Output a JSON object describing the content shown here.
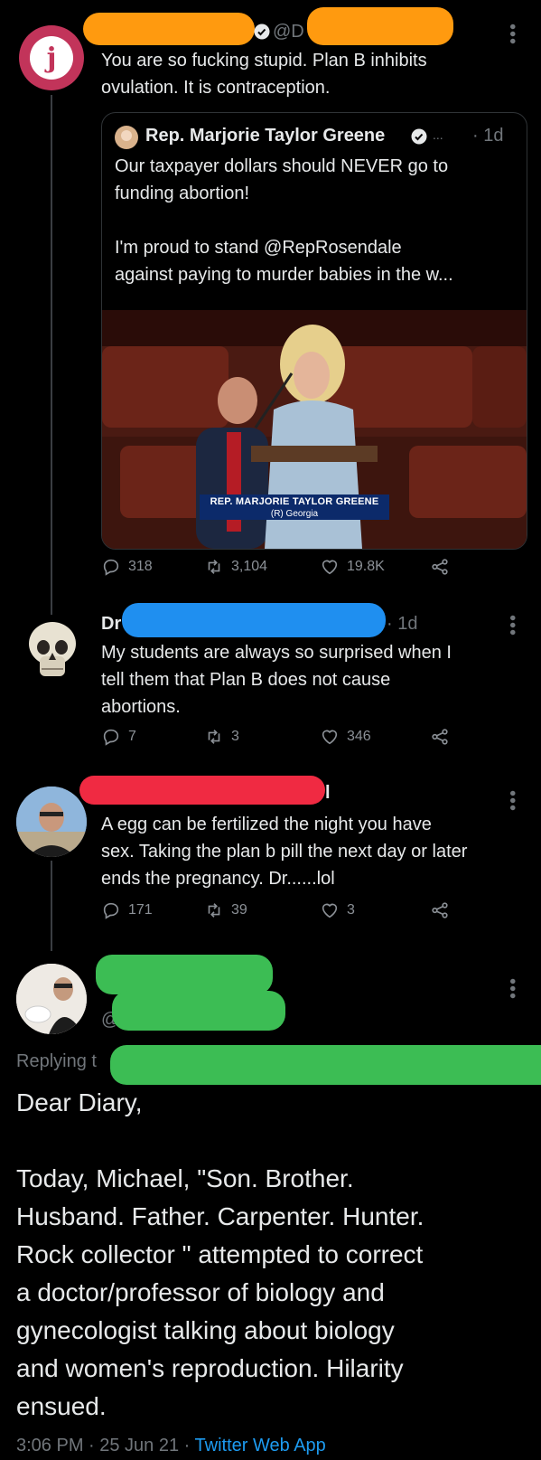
{
  "tweet1": {
    "handle_fragment": "@D",
    "text_lines": [
      "You are so fucking stupid. Plan B inhibits",
      "ovulation. It is contraception."
    ],
    "quote": {
      "name": "Rep. Marjorie Taylor Greene",
      "ellipsis": "...",
      "time": "· 1d",
      "text_lines": [
        "Our taxpayer dollars should NEVER go to",
        "funding abortion!",
        "",
        "I'm proud to stand @RepRosendale",
        "against paying to murder babies in the w..."
      ],
      "image": {
        "chyron_name": "REP. MARJORIE TAYLOR GREENE",
        "chyron_sub": "(R) Georgia"
      }
    },
    "stats": {
      "replies": "318",
      "retweets": "3,104",
      "likes": "19.8K"
    }
  },
  "tweet2": {
    "name_fragment": "Dr",
    "time": "· 1d",
    "text_lines": [
      "My students are always so surprised when I",
      "tell them that Plan B does not cause",
      "abortions."
    ],
    "stats": {
      "replies": "7",
      "retweets": "3",
      "likes": "346"
    }
  },
  "tweet3": {
    "name_tail": "l",
    "text_lines": [
      "A egg can be fertilized the night you have",
      "sex. Taking the plan b pill the next day or later",
      "ends the pregnancy.  Dr......lol"
    ],
    "stats": {
      "replies": "171",
      "retweets": "39",
      "likes": "3"
    }
  },
  "tweet4": {
    "handle_fragment": "@",
    "replying_prefix": "Replying t",
    "text_lines": [
      "Dear Diary,",
      "",
      "Today, Michael, \"Son. Brother.",
      "Husband. Father. Carpenter.  Hunter.",
      "Rock collector \" attempted to correct",
      "a doctor/professor of biology and",
      "gynecologist talking about biology",
      "and women's reproduction. Hilarity",
      "ensued."
    ],
    "timestamp": "3:06 PM · 25 Jun 21 · ",
    "source": "Twitter Web App"
  },
  "colors": {
    "background": "#000000",
    "text": "#e7e9ea",
    "muted": "#71767b",
    "link": "#1d9bf0",
    "redact_orange": "#ff9a0f",
    "redact_blue": "#1f8ff0",
    "redact_red": "#f02a42",
    "redact_green": "#3cbd54"
  }
}
